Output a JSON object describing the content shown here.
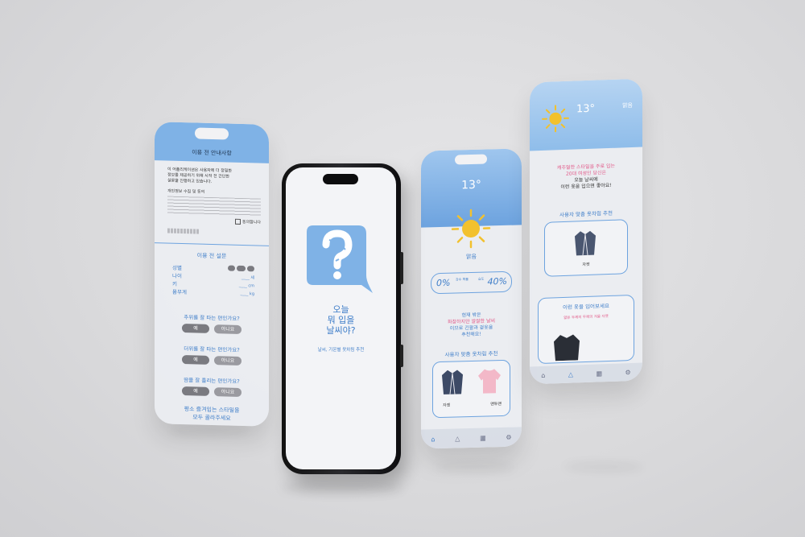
{
  "screen1": {
    "header_title": "이용 전 안내사항",
    "intro": [
      "이 어플리케이션은 사용자에 더 정밀한",
      "정보를 제공하기 위해 시작 전 간단한",
      "설문을 진행하고 있습니다."
    ],
    "privacy_title": "개인정보 수집 및 동의",
    "agree_label": "동의합니다",
    "survey_title": "이용 전 설문",
    "fields": [
      {
        "label": "성별",
        "unit": ""
      },
      {
        "label": "나이",
        "unit": "세"
      },
      {
        "label": "키",
        "unit": "cm"
      },
      {
        "label": "몸무게",
        "unit": "kg"
      }
    ],
    "questions": [
      "추위를 잘 타는 편인가요?",
      "더위를 잘 타는 편인가요?",
      "땀을 잘 흘리는 편인가요?"
    ],
    "yes_label": "예",
    "no_label": "아니요",
    "style_prompt": [
      "평소 즐겨입는 스타일을",
      "모두 골라주세요"
    ]
  },
  "screen2": {
    "title_lines": [
      "오늘",
      "뭐 입을",
      "날씨야?"
    ],
    "subtitle": "날씨, 기온별 옷차림 추천"
  },
  "screen3": {
    "temperature": "13°",
    "condition": "맑음",
    "rain_value": "0%",
    "rain_label": "강수 확률",
    "humidity_value": "40%",
    "humidity_label": "습도",
    "message": [
      "현재 밖은",
      "화창하지만 쌀쌀한 날씨",
      "이므로 긴팔과 겉옷을",
      "추천해요!"
    ],
    "rec_title": "사용자 맞춤 옷차림 추천",
    "items": [
      "자켓",
      "맨투맨"
    ]
  },
  "screen4": {
    "temperature": "13°",
    "condition": "맑음",
    "message": [
      "캐주얼한 스타일을 주로 입는",
      "20대 여성인 당신은",
      "오늘 날씨에",
      "이런 옷을 입으면 좋아요!"
    ],
    "rec_title": "사용자 맞춤 옷차림 추천",
    "item": "자켓",
    "alt_title": "이런 옷을 입어보세요",
    "alt_sub": "얇은 두께의 두께의 겨울 자켓"
  },
  "colors": {
    "accent": "#6da3df",
    "pink": "#e25b8a",
    "sun": "#f2c12e"
  }
}
